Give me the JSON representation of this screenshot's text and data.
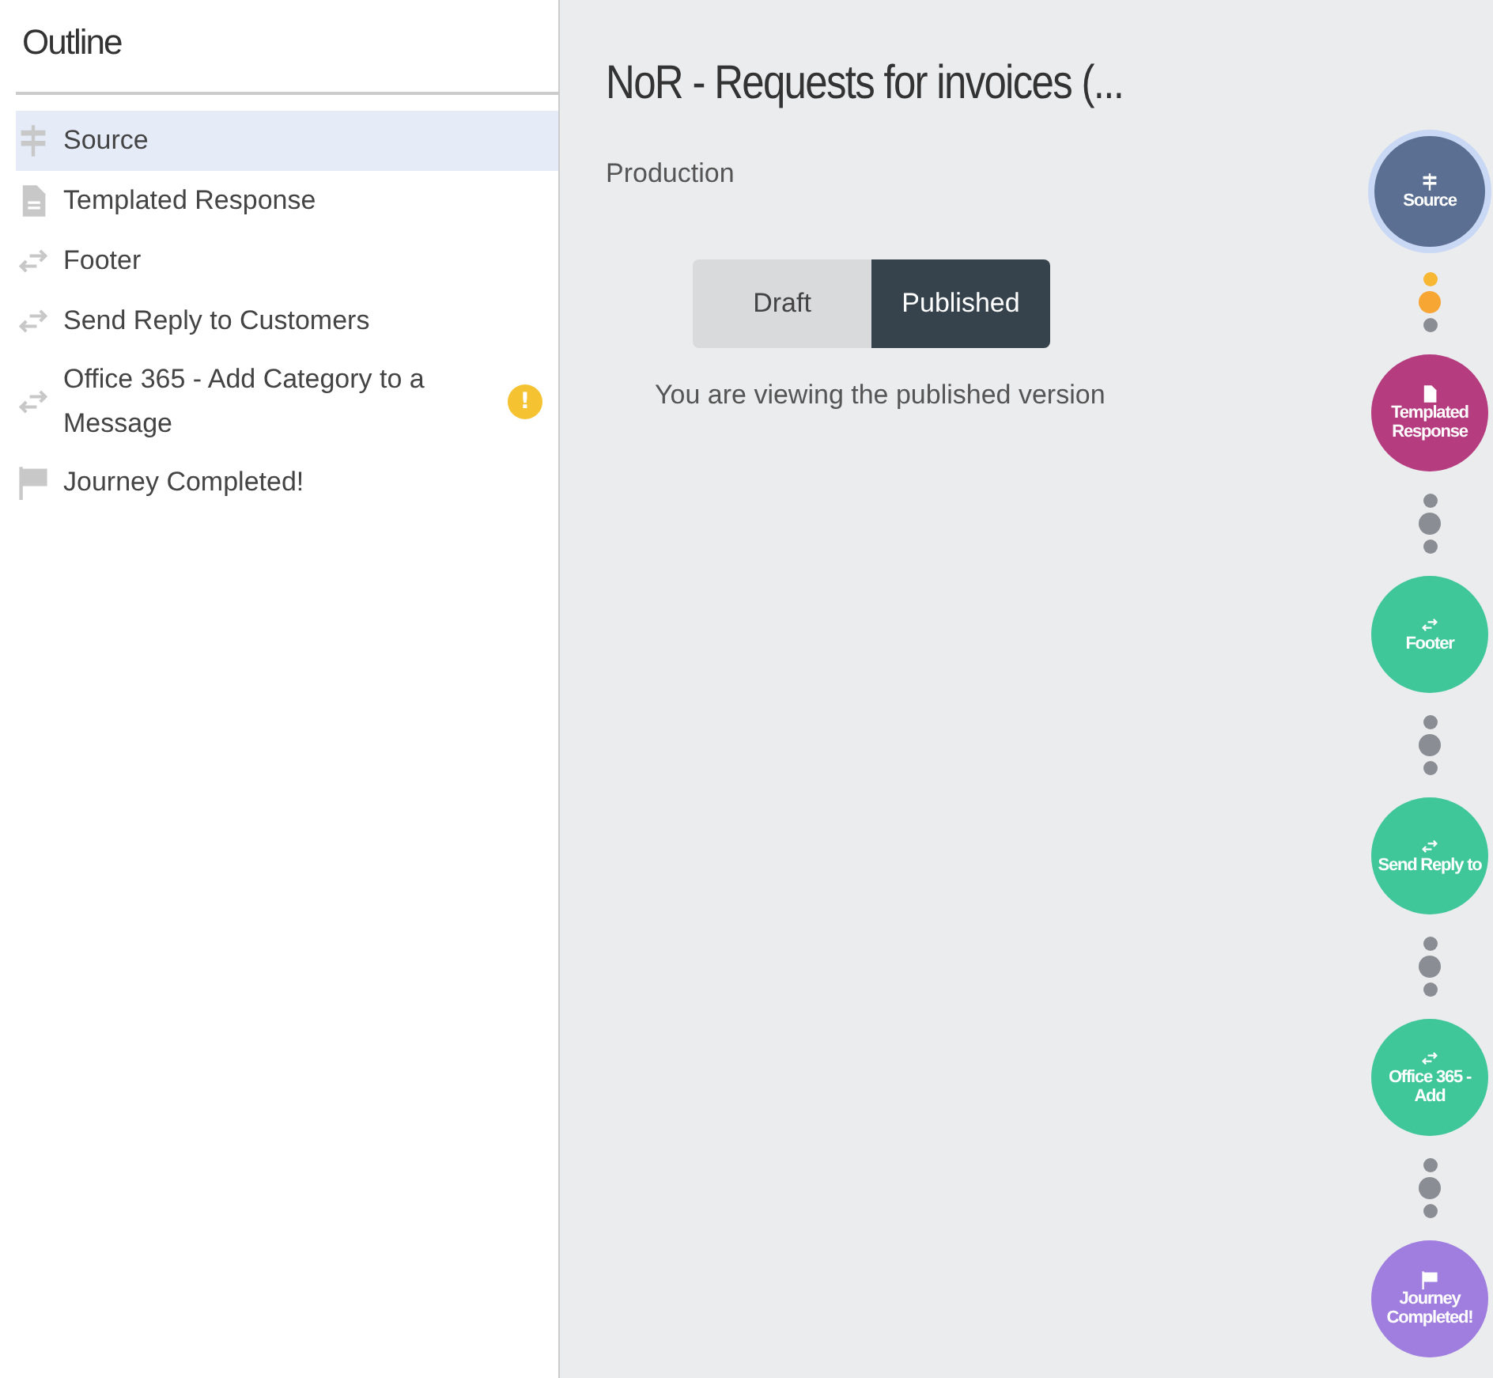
{
  "outline": {
    "title": "Outline",
    "items": [
      {
        "label": "Source",
        "kind": "source",
        "selected": true,
        "warning": false
      },
      {
        "label": "Templated Response",
        "kind": "document",
        "selected": false,
        "warning": false
      },
      {
        "label": "Footer",
        "kind": "transfer",
        "selected": false,
        "warning": false
      },
      {
        "label": "Send Reply to Customers",
        "kind": "transfer",
        "selected": false,
        "warning": false
      },
      {
        "label": "Office 365 - Add Category to a Message",
        "kind": "transfer",
        "selected": false,
        "warning": true,
        "warning_text": "!"
      },
      {
        "label": "Journey Completed!",
        "kind": "flag",
        "selected": false,
        "warning": false
      }
    ]
  },
  "main": {
    "title": "NoR - Requests for invoices (...",
    "environment": "Production",
    "versions": [
      {
        "label": "Draft",
        "selected": false
      },
      {
        "label": "Published",
        "selected": true
      }
    ],
    "status": "You are viewing the published version"
  },
  "journey": [
    {
      "label": "Source",
      "kind": "source",
      "color": "#5a6f92",
      "selected": true
    },
    {
      "label": "Templated Response",
      "kind": "document",
      "color": "#b63c80",
      "selected": false
    },
    {
      "label": "Footer",
      "kind": "transfer",
      "color": "#3fc79a",
      "selected": false
    },
    {
      "label": "Send Reply to",
      "kind": "transfer",
      "color": "#3fc79a",
      "selected": false
    },
    {
      "label": "Office 365 - Add",
      "kind": "transfer",
      "color": "#3fc79a",
      "selected": false
    },
    {
      "label": "Journey Completed!",
      "kind": "flag",
      "color": "#a07ee0",
      "selected": false
    }
  ],
  "connectors": [
    {
      "highlighted": true
    },
    {
      "highlighted": false
    },
    {
      "highlighted": false
    },
    {
      "highlighted": false
    },
    {
      "highlighted": false
    }
  ]
}
